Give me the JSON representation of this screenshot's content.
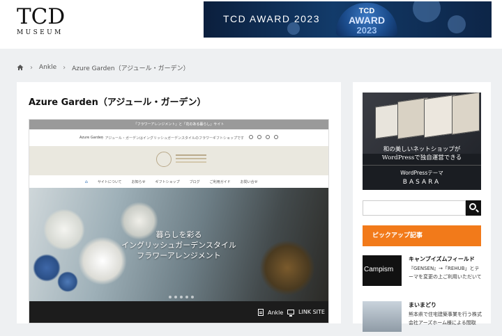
{
  "header": {
    "logo_main": "TCD",
    "logo_sub": "MUSEUM",
    "banner_text": "TCD AWARD 2023",
    "badge_line1": "TCD",
    "badge_line2": "AWARD",
    "badge_line3": "2023"
  },
  "breadcrumb": {
    "items": [
      "Ankle",
      "Azure Garden（アジュール・ガーデン）"
    ]
  },
  "main": {
    "title": "Azure Garden（アジュール・ガーデン）",
    "screenshot": {
      "topbar": "「フラワーアレンジメント」と「花のある暮らし」サイト",
      "site_name": "Azure Garden",
      "site_desc": "｜ アジュール・ガーデンはイングリッシュガーデンスタイルのフラワーギフトショップです",
      "nav": [
        "サイトについて",
        "お知らせ",
        "ギフトショップ",
        "ブログ",
        "ご利用ガイド",
        "お問い合せ"
      ],
      "hero_line1": "暮らしを彩る",
      "hero_line2": "イングリッシュガーデンスタイル",
      "hero_line3": "フラワーアレンジメント",
      "footer_category": "Ankle",
      "footer_link": "LINK SITE"
    }
  },
  "sidebar": {
    "promo_caption_1": "和の美しいネットショップが",
    "promo_caption_2": "WordPressで独自運営できる",
    "promo_sub": "WordPressテーマ",
    "promo_basara": "BASARA",
    "search_placeholder": "",
    "pickup_label": "ピックアップ記事",
    "articles": [
      {
        "title": "キャンプイズムフィールド",
        "desc": "『GENSEN』→「REHUB」とテーマを変更の上ご利用いただいて",
        "thumb_text": "Campism"
      },
      {
        "title": "まいまどり",
        "desc": "熊本県で住宅建築事業を行う株式会社アーズホーム様による間取"
      }
    ]
  }
}
